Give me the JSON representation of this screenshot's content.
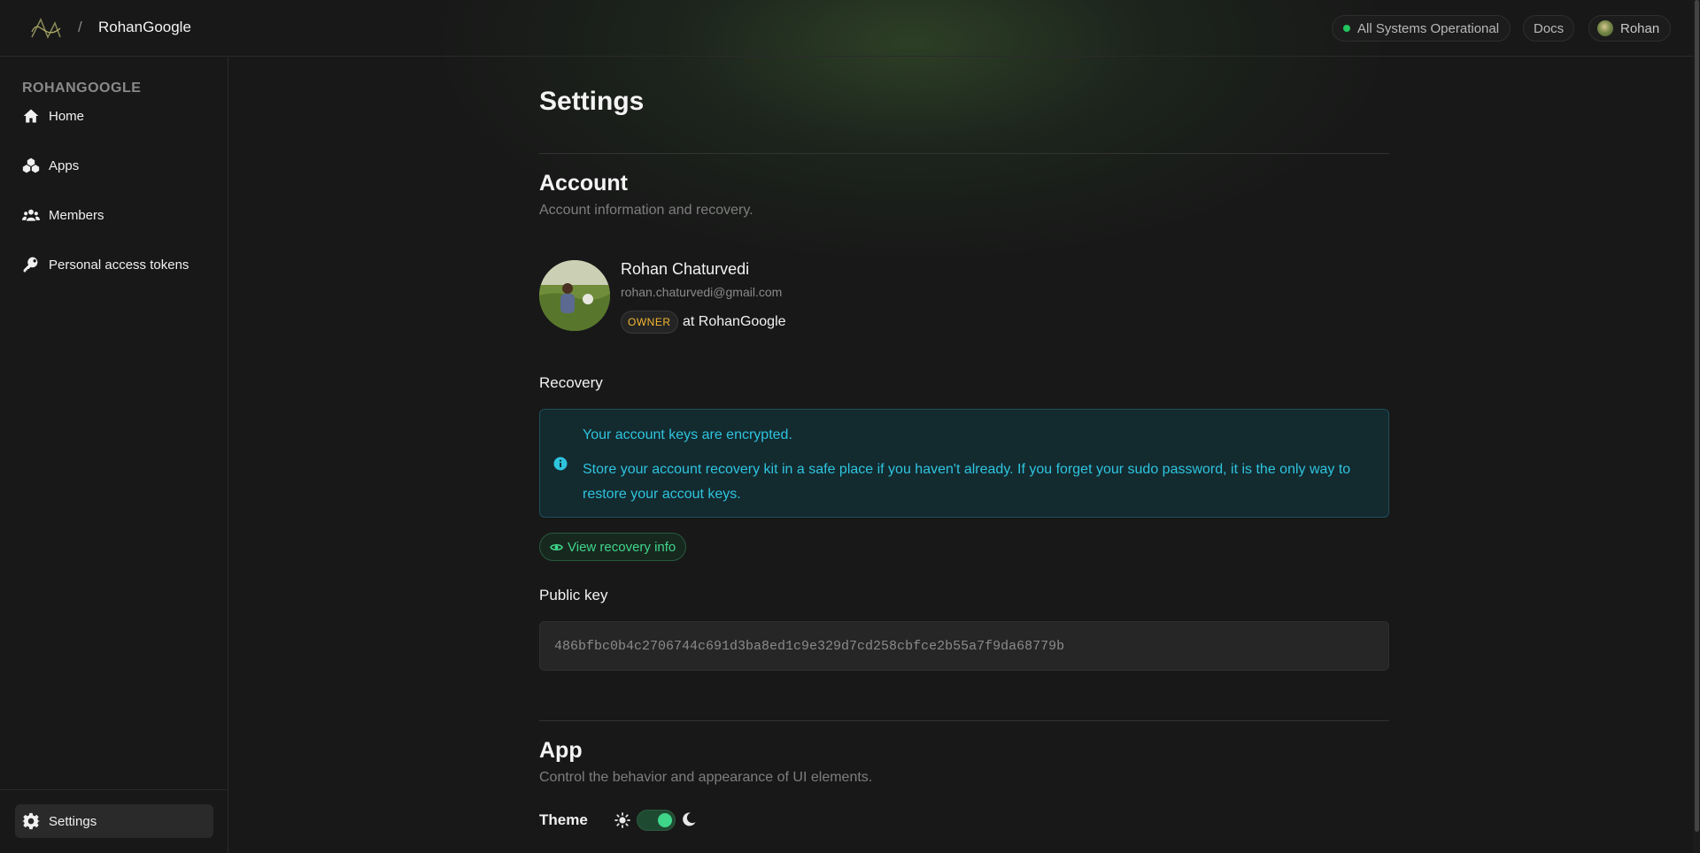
{
  "header": {
    "org_name": "RohanGoogle",
    "separator": "/",
    "status_text": "All Systems Operational",
    "docs_label": "Docs",
    "user_label": "Rohan"
  },
  "sidebar": {
    "title": "ROHANGOOGLE",
    "items": [
      {
        "label": "Home",
        "icon": "home-icon"
      },
      {
        "label": "Apps",
        "icon": "apps-icon"
      },
      {
        "label": "Members",
        "icon": "members-icon"
      },
      {
        "label": "Personal access tokens",
        "icon": "key-icon"
      }
    ],
    "settings_label": "Settings"
  },
  "main": {
    "page_title": "Settings",
    "account": {
      "title": "Account",
      "subtitle": "Account information and recovery.",
      "name": "Rohan Chaturvedi",
      "email": "rohan.chaturvedi@gmail.com",
      "role": "OWNER",
      "role_org": "at RohanGoogle"
    },
    "recovery": {
      "title": "Recovery",
      "alert_line1": "Your account keys are encrypted.",
      "alert_line2": "Store your account recovery kit in a safe place if you haven't already. If you forget your sudo password, it is the only way to restore your accout keys.",
      "button_label": "View recovery info"
    },
    "public_key": {
      "title": "Public key",
      "value": "486bfbc0b4c2706744c691d3ba8ed1c9e329d7cd258cbfce2b55a7f9da68779b"
    },
    "app": {
      "title": "App",
      "subtitle": "Control the behavior and appearance of UI elements.",
      "theme_label": "Theme",
      "theme_dark": true
    }
  },
  "colors": {
    "accent_green": "#3fd68a",
    "info_cyan": "#2ec4de",
    "owner_badge": "#f5b731",
    "status_ok": "#22c55e"
  }
}
